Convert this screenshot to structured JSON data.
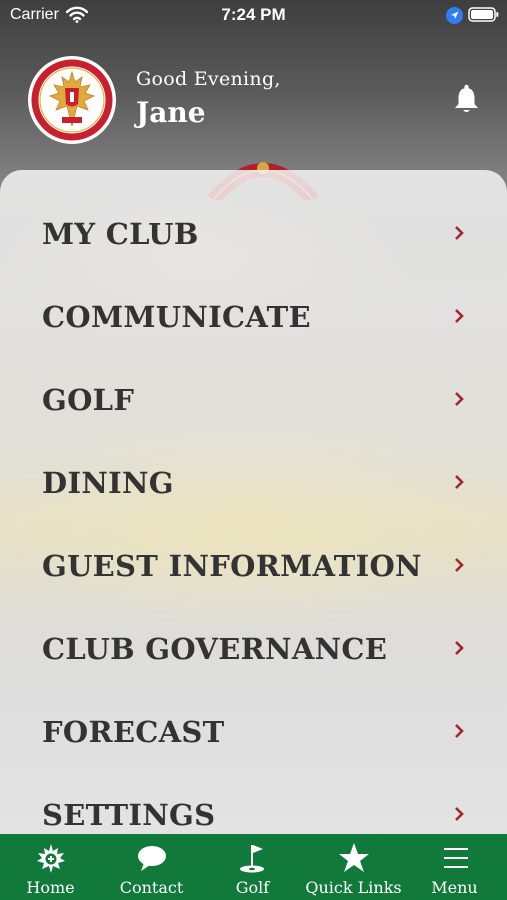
{
  "status_bar": {
    "carrier": "Carrier",
    "time": "7:24 PM"
  },
  "header": {
    "greeting": "Good Evening,",
    "user_name": "Jane"
  },
  "menu": {
    "items": [
      {
        "label": "MY CLUB"
      },
      {
        "label": "COMMUNICATE"
      },
      {
        "label": "GOLF"
      },
      {
        "label": "DINING"
      },
      {
        "label": "GUEST INFORMATION"
      },
      {
        "label": "CLUB GOVERNANCE"
      },
      {
        "label": "FORECAST"
      },
      {
        "label": "SETTINGS"
      }
    ]
  },
  "tabbar": {
    "tabs": [
      {
        "label": "Home",
        "icon": "club-emblem-icon"
      },
      {
        "label": "Contact",
        "icon": "chat-bubble-icon"
      },
      {
        "label": "Golf",
        "icon": "golf-flag-icon"
      },
      {
        "label": "Quick Links",
        "icon": "star-icon"
      },
      {
        "label": "Menu",
        "icon": "hamburger-icon"
      }
    ]
  },
  "colors": {
    "tab_bar": "#117a3a",
    "chevron": "#a3262e",
    "menu_text": "#333333",
    "emblem_red": "#c8202f"
  }
}
